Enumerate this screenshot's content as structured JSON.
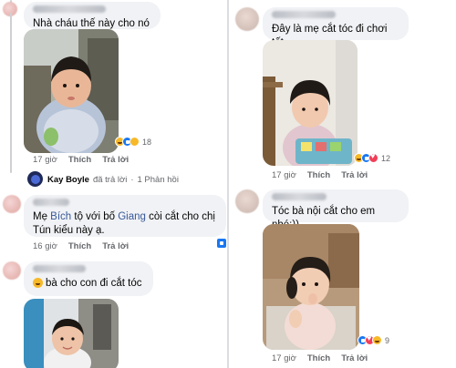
{
  "left": {
    "comment1": {
      "author": "Mo... Th...",
      "text": "Nhà cháu thế này cho nó mát",
      "time": "17 giờ",
      "like_label": "Thích",
      "reply_label": "Trả lời",
      "reaction_count": "18"
    },
    "kay_reply": {
      "name": "Kay Boyle",
      "action": "đã trả lời",
      "sep": "·",
      "count": "1 Phản hồi"
    },
    "comment2": {
      "author": "Anh...",
      "text_prefix": "Mẹ ",
      "mention1": "Bích",
      "text_mid": " tộ với bố ",
      "mention2": "Giang",
      "text_suffix": " còi cắt cho chị Tún kiểu này ạ.",
      "time": "16 giờ",
      "like_label": "Thích",
      "reply_label": "Trả lời"
    },
    "comment3": {
      "author": "Th... Tr...",
      "text": "bà cho con đi cắt tóc"
    }
  },
  "right": {
    "comment1": {
      "author": "Ng... Ng...",
      "text": "Đây là mẹ cắt tóc đi chơi tết",
      "time": "17 giờ",
      "like_label": "Thích",
      "reply_label": "Trả lời",
      "reaction_count": "12"
    },
    "comment2": {
      "author": "Ng... Ph...",
      "text": "Tóc bà nội cắt cho em nhé:))",
      "time": "17 giờ",
      "like_label": "Thích",
      "reply_label": "Trả lời",
      "reaction_count": "9"
    }
  },
  "colors": {
    "link": "#385898",
    "meta": "#65676b",
    "bubble": "#f0f2f5"
  }
}
